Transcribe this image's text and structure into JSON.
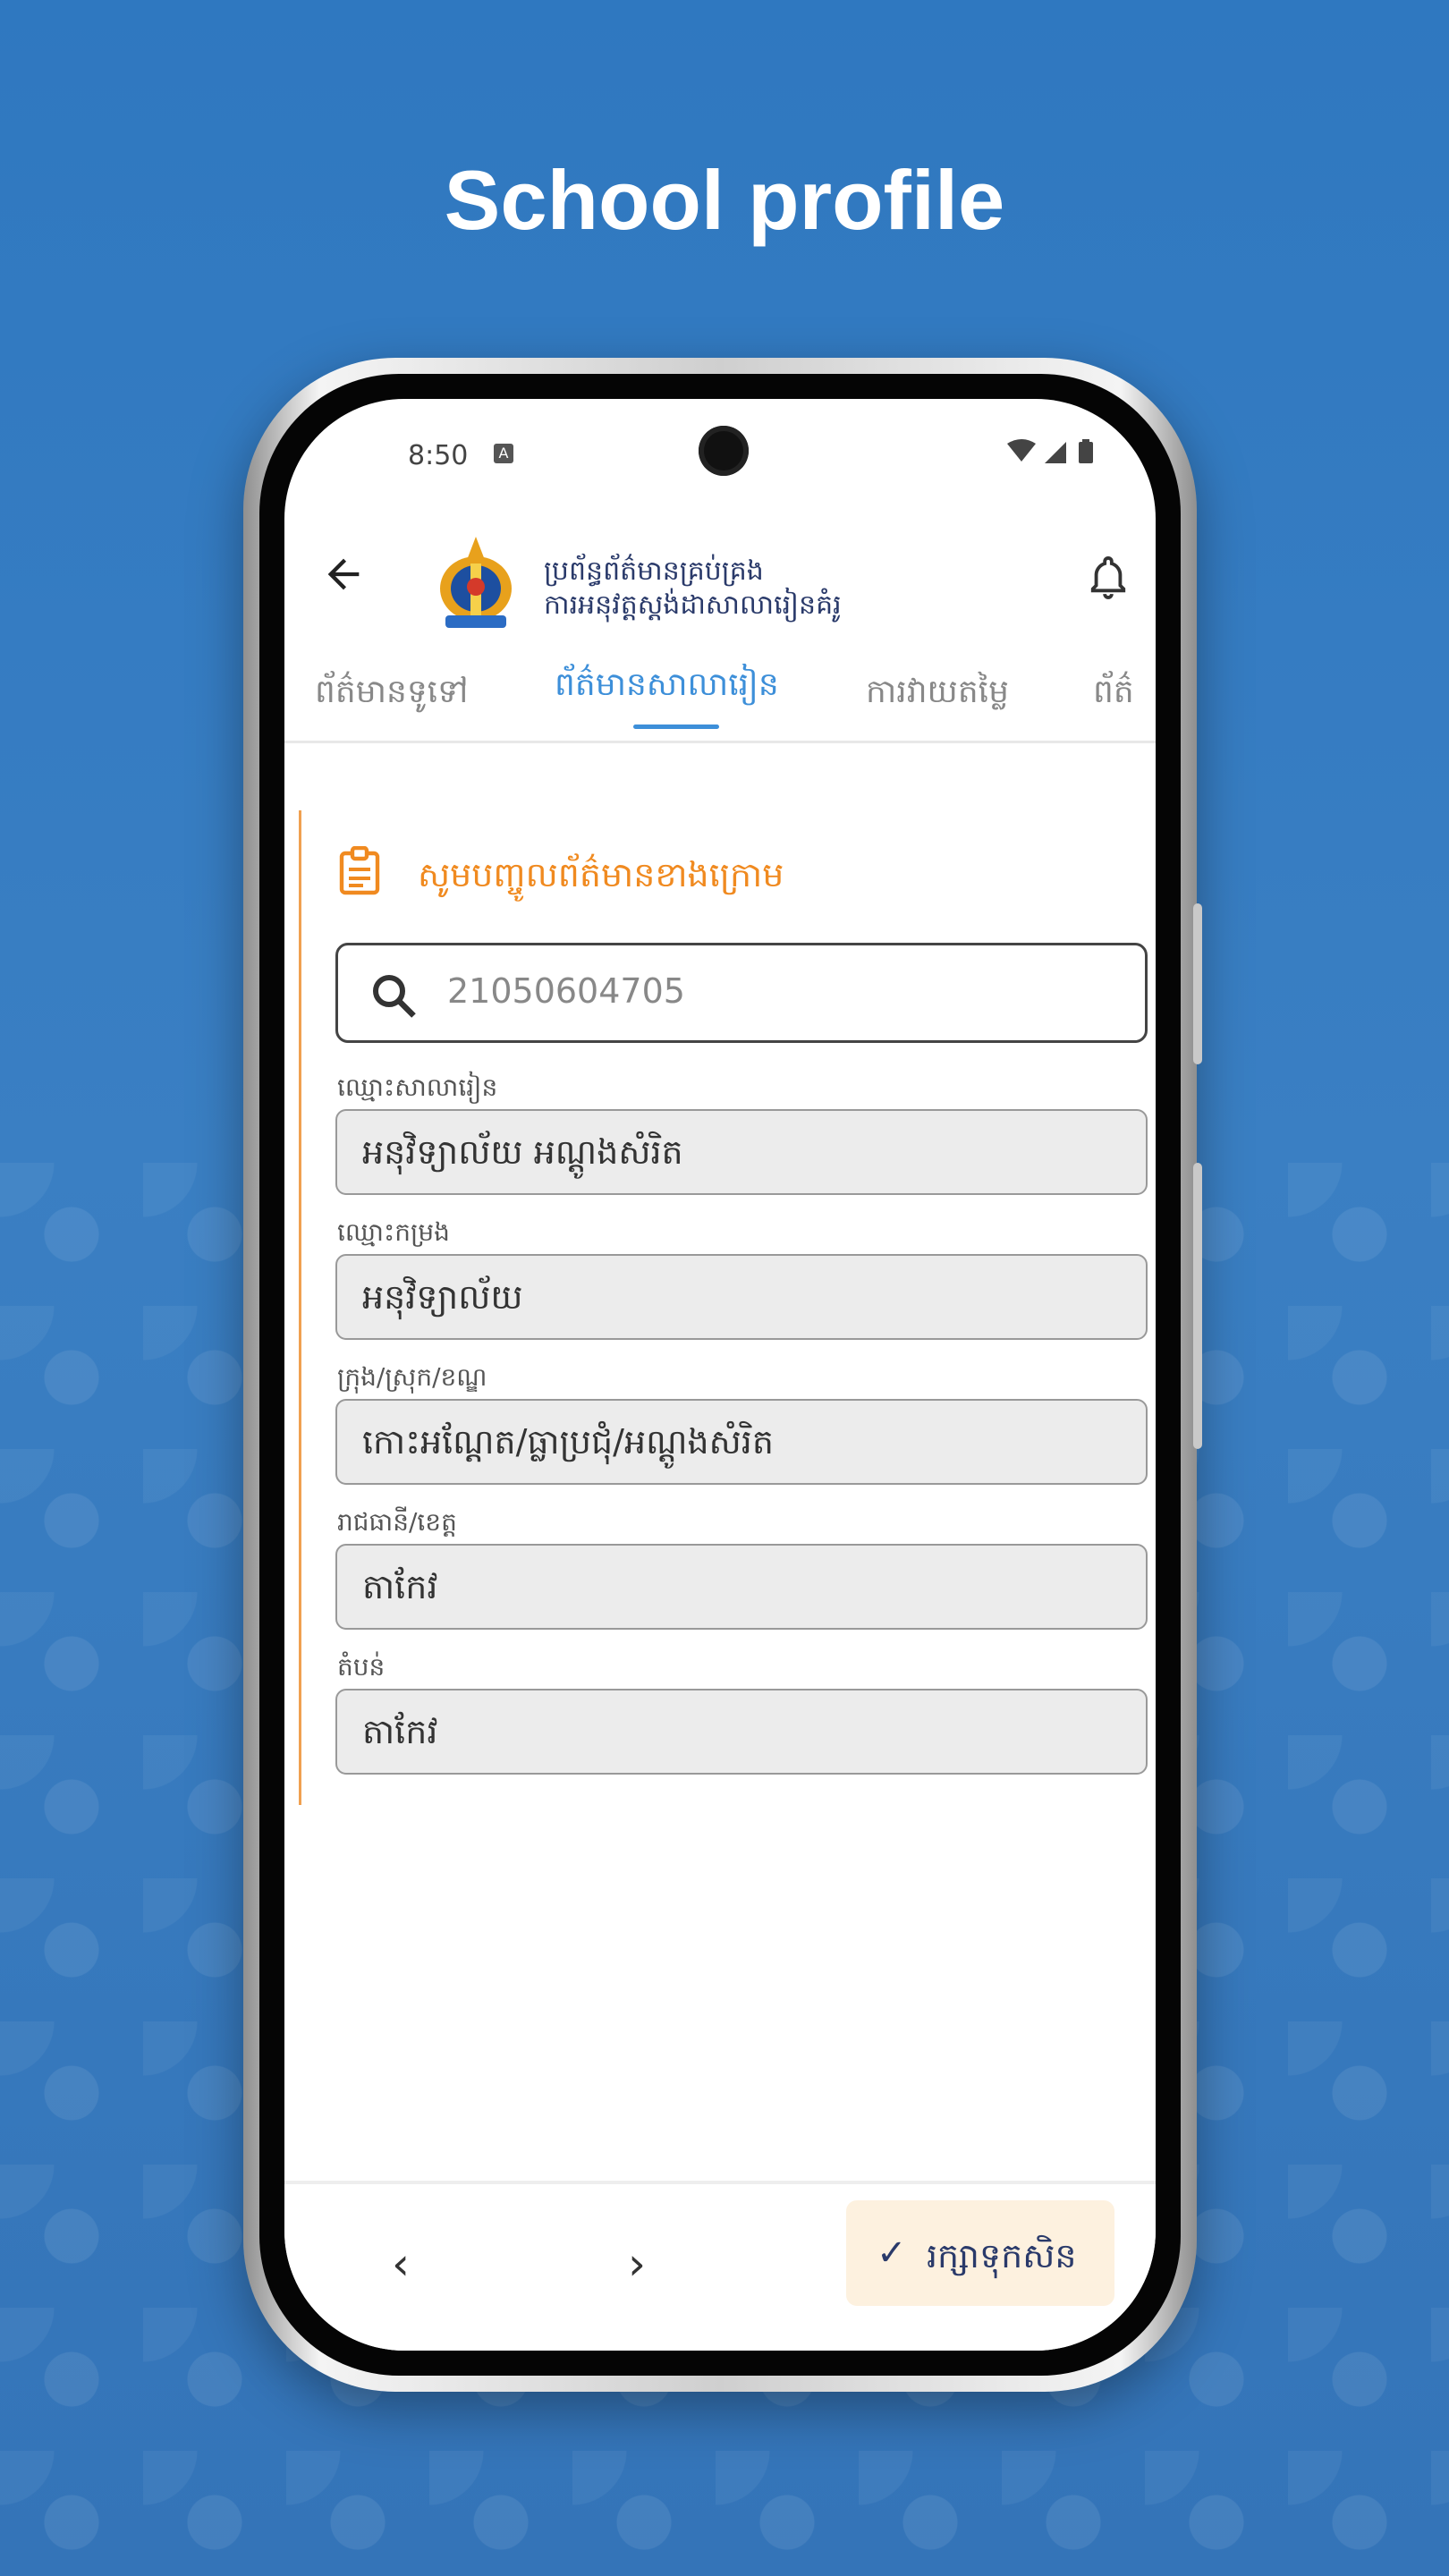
{
  "headline": "School profile",
  "status_bar": {
    "time": "8:50",
    "notification_icon": "A",
    "icons": "▾◢▮"
  },
  "app": {
    "title_line1": "ប្រព័ន្ធព័ត៌មានគ្រប់គ្រង",
    "title_line2": "ការអនុវត្តស្តង់ដាសាលារៀនគំរូ",
    "icons": {
      "back": "arrow-left-icon",
      "notifications": "bell-icon",
      "logo": "ministry-emblem"
    }
  },
  "tabs": [
    {
      "label": "ព័ត៌មានទូទៅ",
      "active": false
    },
    {
      "label": "ព័ត៌មានសាលារៀន",
      "active": true
    },
    {
      "label": "ការវាយតម្លៃ",
      "active": false
    },
    {
      "label": "ព័ត៌",
      "active": false
    }
  ],
  "form": {
    "header": "សូមបញ្ចូលព័ត៌មានខាងក្រោម",
    "search": {
      "value": "21050604705"
    },
    "fields": [
      {
        "label": "ឈ្មោះសាលារៀន",
        "value": "អនុវិទ្យាល័យ អណ្តូងសំរិត"
      },
      {
        "label": "ឈ្មោះកម្រង",
        "value": "អនុវិទ្យាល័យ"
      },
      {
        "label": "ក្រុង/ស្រុក/ខណ្ឌ",
        "value": "កោះអណ្តែត/ធ្លាប្រជុំ/អណ្តូងសំរិត"
      },
      {
        "label": "រាជធានី/ខេត្ត",
        "value": "តាកែវ"
      },
      {
        "label": "តំបន់",
        "value": "តាកែវ"
      }
    ]
  },
  "bottom": {
    "prev": "‹",
    "next": "›",
    "save_check": "✓",
    "save_label": "រក្សាទុកសិន"
  },
  "colors": {
    "accent_blue": "#3d8fd9",
    "accent_orange": "#f08a20",
    "save_bg": "#fdf1df"
  }
}
